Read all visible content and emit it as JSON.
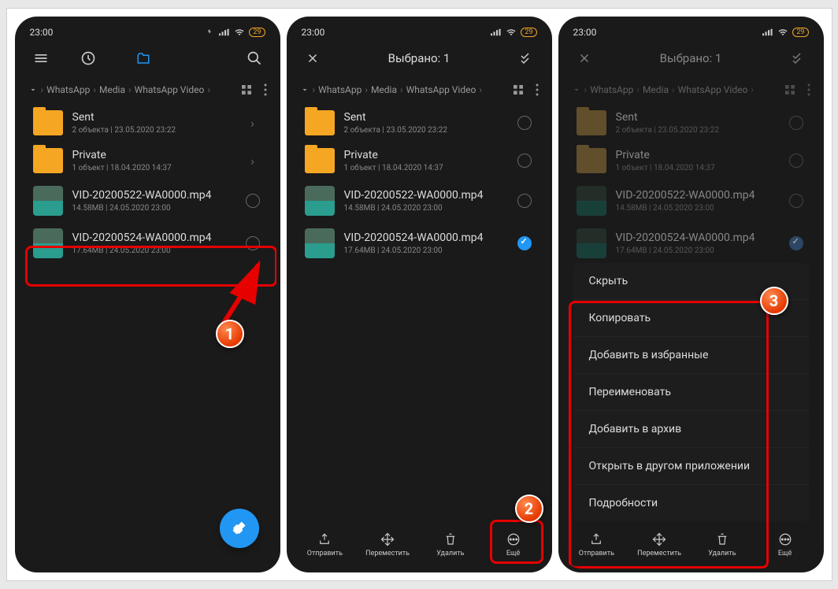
{
  "statusbar": {
    "time": "23:00",
    "battery": "29"
  },
  "browse_toolbar": {
    "recent": "⏱",
    "folder": "📁",
    "search": "🔍",
    "menu": "☰"
  },
  "select_toolbar": {
    "title": "Выбрано: 1"
  },
  "breadcrumb": {
    "items": [
      "WhatsApp",
      "Media",
      "WhatsApp Video"
    ]
  },
  "files": {
    "sent": {
      "name": "Sent",
      "meta": "2 объекта  |  23.05.2020 23:22"
    },
    "private": {
      "name": "Private",
      "meta": "1 объект  |  18.04.2020 14:37"
    },
    "vid22": {
      "name": "VID-20200522-WA0000.mp4",
      "meta": "14.58MB  |  24.05.2020 23:00"
    },
    "vid24": {
      "name": "VID-20200524-WA0000.mp4",
      "meta": "17.64MB  |  24.05.2020 23:00"
    }
  },
  "actions": {
    "send": "Отправить",
    "move": "Переместить",
    "delete": "Удалить",
    "more": "Ещё"
  },
  "menu": {
    "hide": "Скрыть",
    "copy": "Копировать",
    "favorite": "Добавить в избранные",
    "rename": "Переименовать",
    "archive": "Добавить в архив",
    "openwith": "Открыть в другом приложении",
    "details": "Подробности"
  },
  "indicators": {
    "one": "1",
    "two": "2",
    "three": "3"
  }
}
